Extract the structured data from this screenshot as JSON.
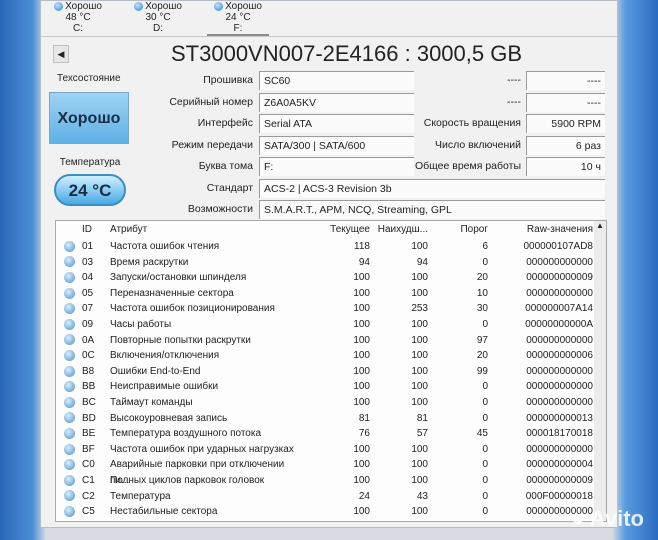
{
  "drives": [
    {
      "status": "Хорошо",
      "temp": "48 °C",
      "letter": "C:"
    },
    {
      "status": "Хорошо",
      "temp": "30 °C",
      "letter": "D:"
    },
    {
      "status": "Хорошо",
      "temp": "24 °C",
      "letter": "F:"
    }
  ],
  "title": "ST3000VN007-2E4166 : 3000,5 GB",
  "health": {
    "label": "Техсостояние",
    "value": "Хорошо"
  },
  "temperature": {
    "label": "Температура",
    "value": "24 °C"
  },
  "info": {
    "firmware": {
      "label": "Прошивка",
      "value": "SC60"
    },
    "serial": {
      "label": "Серийный номер",
      "value": "Z6A0A5KV"
    },
    "interface": {
      "label": "Интерфейс",
      "value": "Serial ATA"
    },
    "transfer": {
      "label": "Режим передачи",
      "value": "SATA/300 | SATA/600"
    },
    "letter": {
      "label": "Буква тома",
      "value": "F:"
    },
    "standard": {
      "label": "Стандарт",
      "value": "ACS-2 | ACS-3 Revision 3b"
    },
    "features": {
      "label": "Возможности",
      "value": "S.M.A.R.T., APM, NCQ, Streaming, GPL"
    },
    "r1": {
      "label": "----",
      "value": "----"
    },
    "r2": {
      "label": "----",
      "value": "----"
    },
    "rpm": {
      "label": "Скорость вращения",
      "value": "5900 RPM"
    },
    "power_count": {
      "label": "Число включений",
      "value": "6 раз"
    },
    "hours": {
      "label": "Общее время работы",
      "value": "10 ч"
    }
  },
  "table": {
    "headers": [
      "ID",
      "Атрибут",
      "Текущее",
      "Наихудш...",
      "Порог",
      "Raw-значения"
    ],
    "rows": [
      [
        "01",
        "Частота ошибок чтения",
        "118",
        "100",
        "6",
        "000000107AD8"
      ],
      [
        "03",
        "Время раскрутки",
        "94",
        "94",
        "0",
        "000000000000"
      ],
      [
        "04",
        "Запуски/остановки шпинделя",
        "100",
        "100",
        "20",
        "000000000009"
      ],
      [
        "05",
        "Переназначенные сектора",
        "100",
        "100",
        "10",
        "000000000000"
      ],
      [
        "07",
        "Частота ошибок позиционирования",
        "100",
        "253",
        "30",
        "000000007A14"
      ],
      [
        "09",
        "Часы работы",
        "100",
        "100",
        "0",
        "00000000000A"
      ],
      [
        "0A",
        "Повторные попытки раскрутки",
        "100",
        "100",
        "97",
        "000000000000"
      ],
      [
        "0C",
        "Включения/отключения",
        "100",
        "100",
        "20",
        "000000000006"
      ],
      [
        "B8",
        "Ошибки End-to-End",
        "100",
        "100",
        "99",
        "000000000000"
      ],
      [
        "BB",
        "Неисправимые ошибки",
        "100",
        "100",
        "0",
        "000000000000"
      ],
      [
        "BC",
        "Таймаут команды",
        "100",
        "100",
        "0",
        "000000000000"
      ],
      [
        "BD",
        "Высокоуровневая запись",
        "81",
        "81",
        "0",
        "000000000013"
      ],
      [
        "BE",
        "Температура воздушного потока",
        "76",
        "57",
        "45",
        "000018170018"
      ],
      [
        "BF",
        "Частота ошибок при ударных нагрузках",
        "100",
        "100",
        "0",
        "000000000000"
      ],
      [
        "C0",
        "Аварийные парковки при отключении пи...",
        "100",
        "100",
        "0",
        "000000000004"
      ],
      [
        "C1",
        "Полных циклов парковок головок",
        "100",
        "100",
        "0",
        "000000000009"
      ],
      [
        "C2",
        "Температура",
        "24",
        "43",
        "0",
        "000F00000018"
      ],
      [
        "C5",
        "Нестабильные сектора",
        "100",
        "100",
        "0",
        "000000000000"
      ]
    ]
  },
  "watermark": "Avito"
}
